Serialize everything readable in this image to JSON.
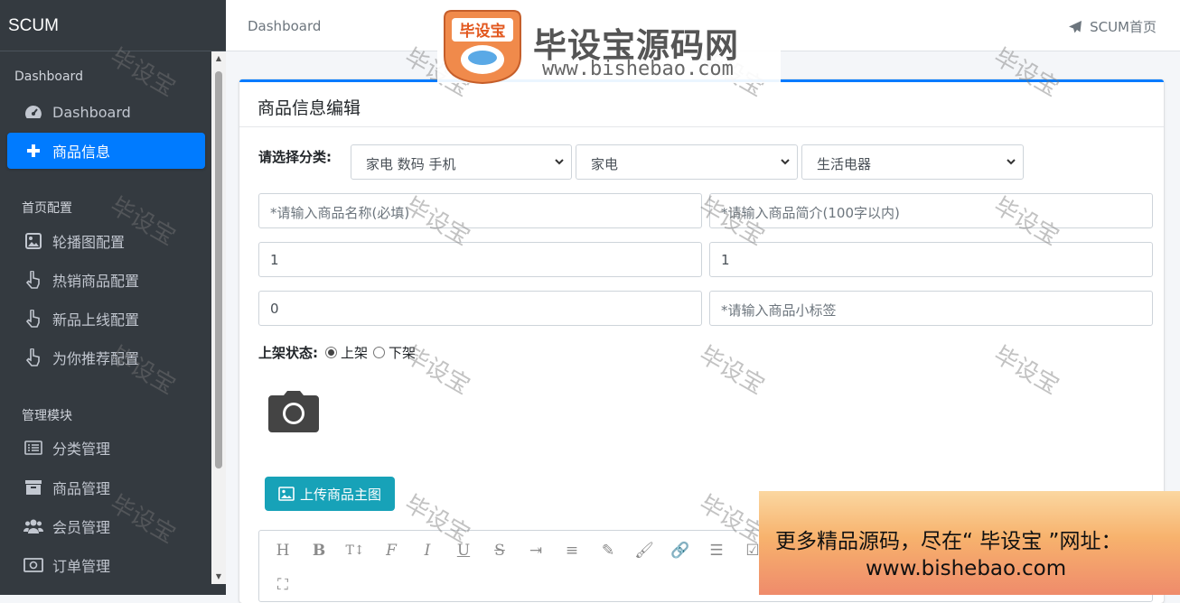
{
  "app": {
    "brand": "SCUM"
  },
  "sidebar": {
    "headers": [
      "Dashboard",
      "首页配置",
      "管理模块"
    ],
    "items": [
      {
        "label": "Dashboard",
        "icon": "dashboard-gauge-icon"
      },
      {
        "label": "商品信息",
        "icon": "plus-icon",
        "active": true
      },
      {
        "label": "轮播图配置",
        "icon": "image-icon"
      },
      {
        "label": "热销商品配置",
        "icon": "hand-pointer-icon"
      },
      {
        "label": "新品上线配置",
        "icon": "hand-pointer-icon"
      },
      {
        "label": "为你推荐配置",
        "icon": "hand-pointer-icon"
      },
      {
        "label": "分类管理",
        "icon": "list-icon"
      },
      {
        "label": "商品管理",
        "icon": "archive-icon"
      },
      {
        "label": "会员管理",
        "icon": "users-icon"
      },
      {
        "label": "订单管理",
        "icon": "money-bill-icon"
      }
    ]
  },
  "topnav": {
    "breadcrumb": "Dashboard",
    "home_link": "SCUM首页"
  },
  "card": {
    "title": "商品信息编辑"
  },
  "form": {
    "category_label": "请选择分类:",
    "category_selects": [
      "家电 数码 手机",
      "家电",
      "生活电器"
    ],
    "name_placeholder": "*请输入商品名称(必填)",
    "intro_placeholder": "*请输入商品简介(100字以内)",
    "original_price": "1",
    "selling_price": "1",
    "stock": "0",
    "tag_placeholder": "*请输入商品小标签",
    "status_label": "上架状态:",
    "status_options": [
      "上架",
      "下架"
    ],
    "status_selected": "上架",
    "upload_button": "上传商品主图"
  },
  "editor_toolbar": [
    "H",
    "B",
    "T↕",
    "F",
    "I",
    "U",
    "S",
    "⇥",
    "≡",
    "✎",
    "🖌",
    "🔗",
    "☰",
    "☑",
    "⛶"
  ],
  "watermark": {
    "text": "毕设宝",
    "logo_badge": "毕设宝",
    "logo_text": "毕设宝源码网",
    "logo_url": "www.bishebao.com",
    "banner_line1": "更多精品源码，尽在“ 毕设宝 ”网址：",
    "banner_line2": "www.bishebao.com"
  },
  "colors": {
    "sidebar_bg": "#343a40",
    "active": "#007bff",
    "info_button": "#17a2b8"
  }
}
